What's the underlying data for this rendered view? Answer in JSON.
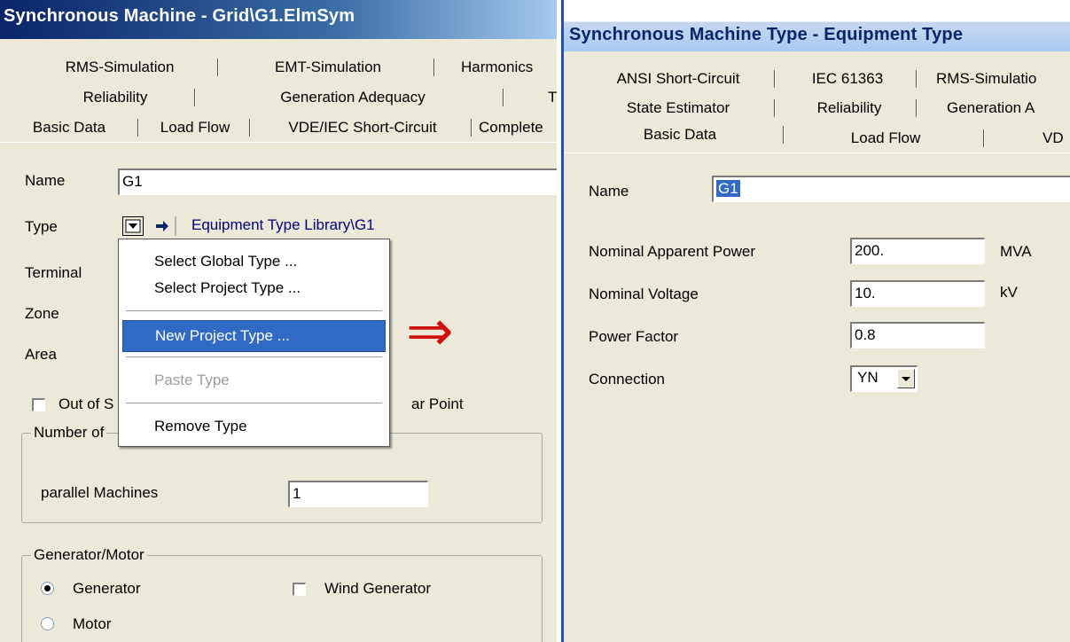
{
  "left_window": {
    "title": "Synchronous Machine - Grid\\G1.ElmSym",
    "tabs_row1": [
      "RMS-Simulation",
      "EMT-Simulation",
      "Harmonics"
    ],
    "tabs_row2": [
      "Reliability",
      "Generation Adequacy",
      "T"
    ],
    "tabs_row3": [
      "Basic Data",
      "Load Flow",
      "VDE/IEC Short-Circuit",
      "Complete"
    ],
    "name_label": "Name",
    "name_value": "G1",
    "type_label": "Type",
    "type_link": "Equipment Type Library\\G1",
    "terminal_label": "Terminal",
    "zone_label": "Zone",
    "area_label": "Area",
    "out_of_service_label": "Out of S",
    "star_point_label": "ar Point",
    "number_group_legend": "Number of",
    "parallel_label": "parallel Machines",
    "parallel_value": "1",
    "genmotor_legend": "Generator/Motor",
    "generator_label": "Generator",
    "motor_label": "Motor",
    "wind_label": "Wind Generator",
    "generator_selected": true
  },
  "context_menu": {
    "items": [
      {
        "label": "Select Global Type ...",
        "state": "normal"
      },
      {
        "label": "Select Project Type ...",
        "state": "normal"
      },
      {
        "label": "New Project Type ...",
        "state": "highlighted"
      },
      {
        "label": "Paste Type",
        "state": "disabled"
      },
      {
        "label": "Remove Type",
        "state": "normal"
      }
    ]
  },
  "arrow_annotation": "⇒",
  "right_window": {
    "title": "Synchronous Machine Type - Equipment Type",
    "tabs_row1": [
      "ANSI Short-Circuit",
      "IEC 61363",
      "RMS-Simulatio"
    ],
    "tabs_row2": [
      "State Estimator",
      "Reliability",
      "Generation A"
    ],
    "tabs_row3": [
      "Basic Data",
      "Load Flow",
      "VD"
    ],
    "name_label": "Name",
    "name_value": "G1",
    "fields": [
      {
        "label": "Nominal Apparent Power",
        "value": "200.",
        "unit": "MVA"
      },
      {
        "label": "Nominal Voltage",
        "value": "10.",
        "unit": "kV"
      },
      {
        "label": "Power Factor",
        "value": "0.8",
        "unit": ""
      }
    ],
    "connection_label": "Connection",
    "connection_value": "YN"
  },
  "colors": {
    "title_gradient_start": "#0A246A",
    "title_gradient_end": "#A6CAF0",
    "window_bg": "#ECE9D8",
    "menu_highlight": "#316AC5",
    "link_text": "#00007F",
    "annotation_arrow": "#D01010"
  }
}
